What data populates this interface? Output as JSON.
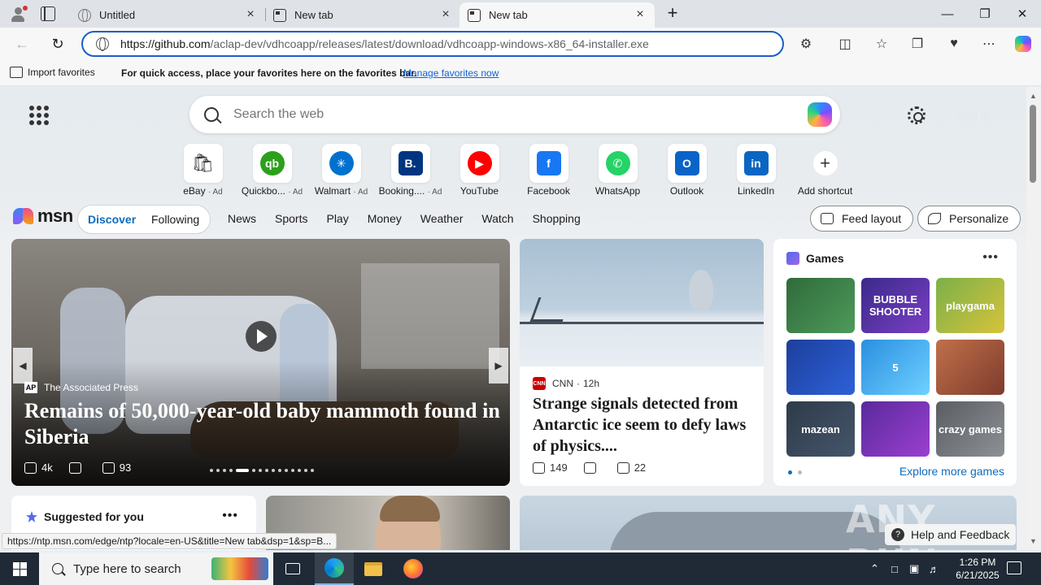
{
  "browser": {
    "tabs": [
      {
        "label": "Untitled",
        "active": false
      },
      {
        "label": "New tab",
        "active": false
      },
      {
        "label": "New tab",
        "active": true
      }
    ],
    "url_host": "https://github.com",
    "url_path": "/aclap-dev/vdhcoapp/releases/latest/download/vdhcoapp-windows-x86_64-installer.exe",
    "window_controls": [
      "minimize",
      "restore",
      "close"
    ]
  },
  "favorites_bar": {
    "import_label": "Import favorites",
    "message": "For quick access, place your favorites here on the favorites bar.",
    "manage_link": "Manage favorites now"
  },
  "ntp": {
    "search_placeholder": "Search the web",
    "signin_label": "Sign in",
    "shortcuts": [
      {
        "label": "eBay",
        "ad": "· Ad",
        "logo": "ebay-logo",
        "color": "#ffffff",
        "glyph": "🛍"
      },
      {
        "label": "Quickbo...",
        "ad": "· Ad",
        "logo": "quickbooks-logo",
        "color": "#2ca01c",
        "glyph": "qb"
      },
      {
        "label": "Walmart",
        "ad": "· Ad",
        "logo": "walmart-logo",
        "color": "#0071ce",
        "glyph": "✳"
      },
      {
        "label": "Booking....",
        "ad": "· Ad",
        "logo": "booking-logo",
        "color": "#003580",
        "glyph": "B."
      },
      {
        "label": "YouTube",
        "ad": "",
        "logo": "youtube-logo",
        "color": "#ff0000",
        "glyph": "▶"
      },
      {
        "label": "Facebook",
        "ad": "",
        "logo": "facebook-logo",
        "color": "#1877f2",
        "glyph": "f"
      },
      {
        "label": "WhatsApp",
        "ad": "",
        "logo": "whatsapp-logo",
        "color": "#25d366",
        "glyph": "✆"
      },
      {
        "label": "Outlook",
        "ad": "",
        "logo": "outlook-logo",
        "color": "#0a64c8",
        "glyph": "O"
      },
      {
        "label": "LinkedIn",
        "ad": "",
        "logo": "linkedin-logo",
        "color": "#0a66c2",
        "glyph": "in"
      },
      {
        "label": "Add shortcut",
        "ad": "",
        "logo": "plus-icon",
        "color": "#ffffff",
        "glyph": "+"
      }
    ]
  },
  "msn": {
    "logo_text": "msn",
    "pill_tabs": [
      "Discover",
      "Following"
    ],
    "nav": [
      "News",
      "Sports",
      "Play",
      "Money",
      "Weather",
      "Watch",
      "Shopping"
    ],
    "feed_layout": "Feed layout",
    "personalize": "Personalize"
  },
  "hero": {
    "source": "The Associated Press",
    "source_badge": "AP",
    "headline": "Remains of 50,000-year-old baby mammoth found in Siberia",
    "likes": "4k",
    "comments": "93"
  },
  "news2": {
    "source": "CNN",
    "source_badge": "CNN",
    "age": "12h",
    "headline": "Strange signals detected from Antarctic ice seem to defy laws of physics....",
    "likes": "149",
    "comments": "22"
  },
  "games": {
    "title": "Games",
    "explore": "Explore more games",
    "tiles": [
      {
        "name": "mahjong",
        "text": "",
        "bg": "linear-gradient(135deg,#2f6b3a,#4e9a5b)"
      },
      {
        "name": "bubble-shooter",
        "text": "BUBBLE SHOOTER",
        "bg": "linear-gradient(135deg,#3a2a8a,#7b3fc4)"
      },
      {
        "name": "playgama-racing",
        "text": "playgama",
        "bg": "linear-gradient(135deg,#7bb04a,#d7c33a)"
      },
      {
        "name": "block-puzzle",
        "text": "",
        "bg": "linear-gradient(135deg,#1d3f9c,#2d61d8)"
      },
      {
        "name": "shark-game",
        "text": "5",
        "bg": "linear-gradient(135deg,#2a8fe0,#6fd0ff)"
      },
      {
        "name": "story-game",
        "text": "",
        "bg": "linear-gradient(135deg,#c0704a,#7e3c2c)"
      },
      {
        "name": "mazean",
        "text": "mazean",
        "bg": "linear-gradient(135deg,#2e3b4a,#45566a)"
      },
      {
        "name": "water-sort",
        "text": "",
        "bg": "linear-gradient(135deg,#5a2a9c,#9b3fd1)"
      },
      {
        "name": "crazy-games-drive",
        "text": "crazy games",
        "bg": "linear-gradient(135deg,#5a5e63,#8d9196)"
      }
    ]
  },
  "suggested": {
    "title": "Suggested for you"
  },
  "status_url": "https://ntp.msn.com/edge/ntp?locale=en-US&title=New tab&dsp=1&sp=B...",
  "feedback": "Help and Feedback",
  "watermark": "ANY RUN",
  "taskbar": {
    "search_placeholder": "Type here to search",
    "time": "1:26 PM",
    "date": "6/21/2025"
  }
}
